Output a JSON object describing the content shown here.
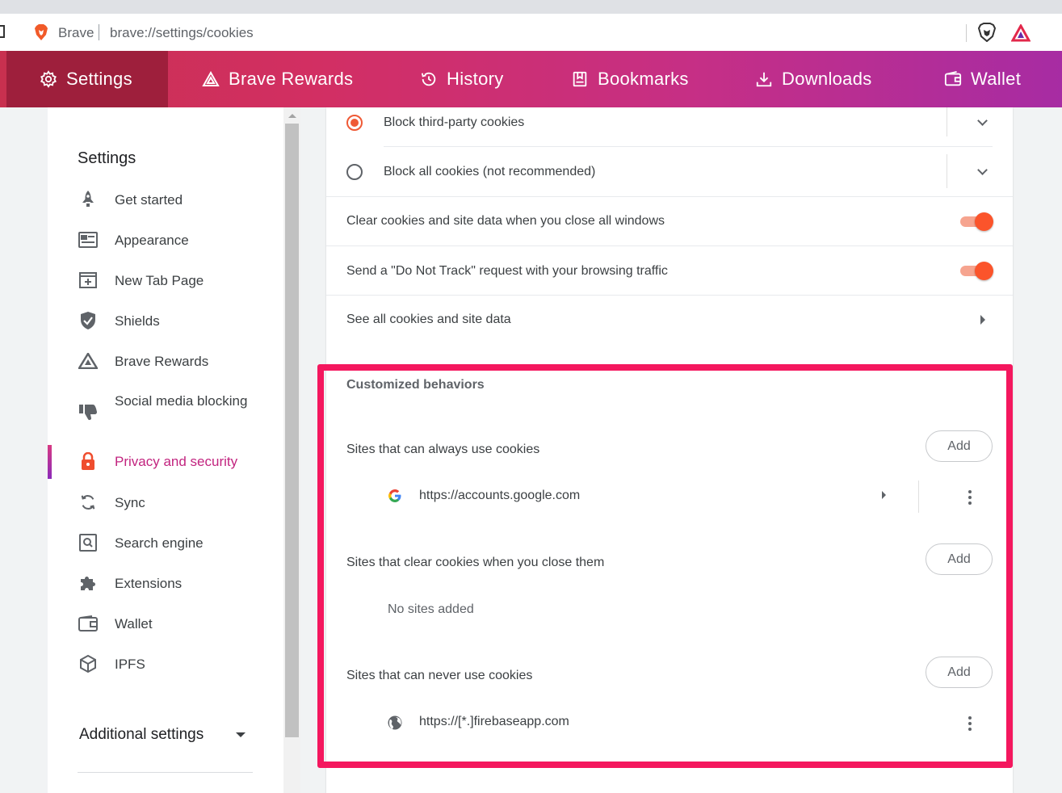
{
  "browser": {
    "brand": "Brave",
    "url": "brave://settings/cookies"
  },
  "topnav": {
    "tabs": [
      {
        "label": "Settings",
        "icon": "gear-icon",
        "active": true
      },
      {
        "label": "Brave Rewards",
        "icon": "triangle-icon"
      },
      {
        "label": "History",
        "icon": "history-icon"
      },
      {
        "label": "Bookmarks",
        "icon": "bookmark-icon"
      },
      {
        "label": "Downloads",
        "icon": "download-icon"
      },
      {
        "label": "Wallet",
        "icon": "wallet-icon"
      }
    ]
  },
  "sidebar": {
    "title": "Settings",
    "items": [
      {
        "label": "Get started",
        "icon": "rocket-icon"
      },
      {
        "label": "Appearance",
        "icon": "appearance-icon"
      },
      {
        "label": "New Tab Page",
        "icon": "new-tab-icon"
      },
      {
        "label": "Shields",
        "icon": "shield-icon"
      },
      {
        "label": "Brave Rewards",
        "icon": "triangle-icon"
      },
      {
        "label": "Social media blocking",
        "icon": "thumbs-down-icon"
      },
      {
        "label": "Privacy and security",
        "icon": "lock-icon",
        "active": true
      },
      {
        "label": "Sync",
        "icon": "sync-icon"
      },
      {
        "label": "Search engine",
        "icon": "search-icon"
      },
      {
        "label": "Extensions",
        "icon": "puzzle-icon"
      },
      {
        "label": "Wallet",
        "icon": "wallet-icon"
      },
      {
        "label": "IPFS",
        "icon": "cube-icon"
      }
    ],
    "additional": "Additional settings"
  },
  "cookies": {
    "block_third_party": "Block third-party cookies",
    "block_all": "Block all cookies (not recommended)",
    "clear_on_close": "Clear cookies and site data when you close all windows",
    "do_not_track": "Send a \"Do Not Track\" request with your browsing traffic",
    "see_all": "See all cookies and site data"
  },
  "customized": {
    "title": "Customized behaviors",
    "add_label": "Add",
    "allow_heading": "Sites that can always use cookies",
    "allow_site": "https://accounts.google.com",
    "clear_heading": "Sites that clear cookies when you close them",
    "no_sites": "No sites added",
    "block_heading": "Sites that can never use cookies",
    "block_site": "https://[*.]firebaseapp.com"
  },
  "colors": {
    "accent": "#fb542b",
    "active_link": "#c2247f",
    "highlight": "#f4175e"
  }
}
